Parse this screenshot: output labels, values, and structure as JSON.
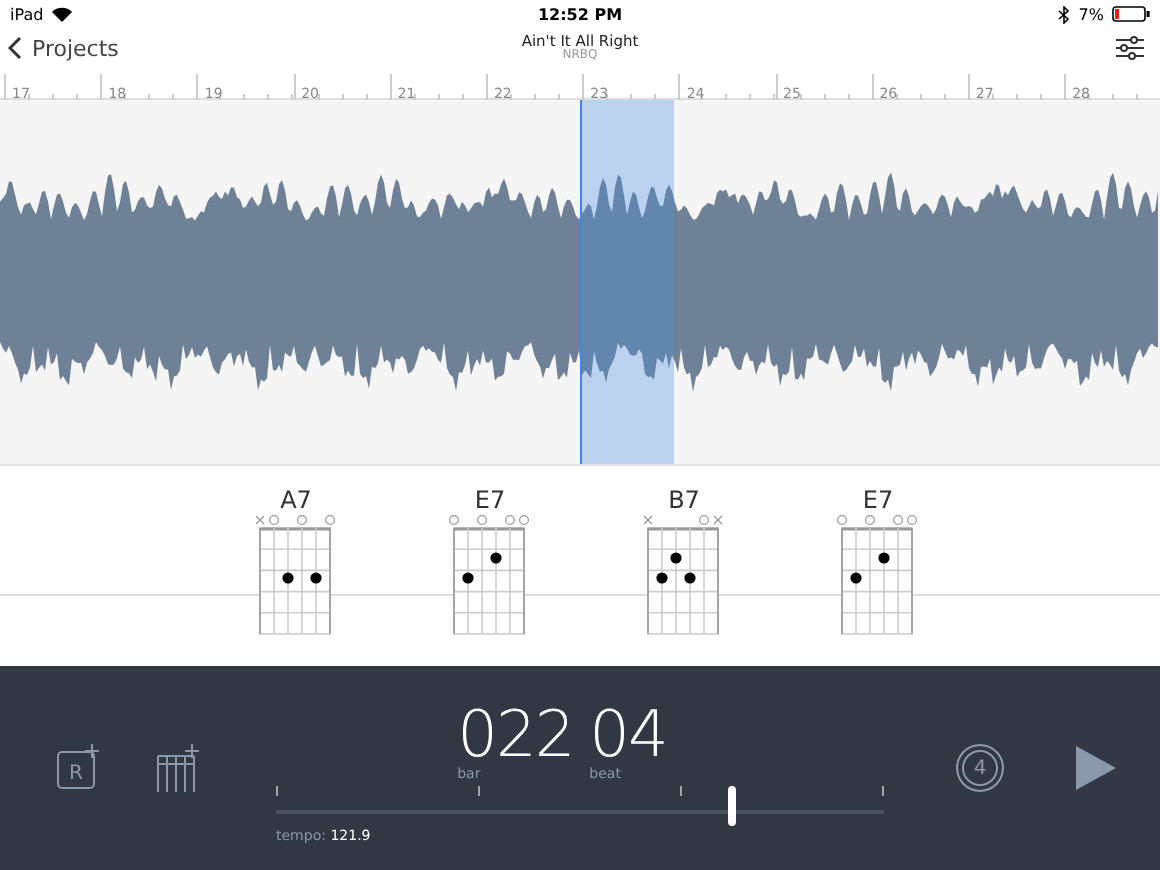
{
  "status_bar": {
    "device": "iPad",
    "time": "12:52 PM",
    "battery": "7%"
  },
  "nav": {
    "back": "Projects",
    "title": "Ain't It All Right",
    "subtitle": "NRBQ"
  },
  "ruler": {
    "bars": [
      "17",
      "18",
      "19",
      "20",
      "21",
      "22",
      "23",
      "24",
      "25",
      "26",
      "27",
      "28"
    ]
  },
  "chords": [
    {
      "name": "A7",
      "strings": [
        {
          "kind": "muted"
        },
        {
          "kind": "open"
        },
        {
          "kind": "fret2"
        },
        {
          "kind": "open"
        },
        {
          "kind": "fret2"
        },
        {
          "kind": "open"
        }
      ]
    },
    {
      "name": "E7",
      "strings": [
        {
          "kind": "open"
        },
        {
          "kind": "fret2"
        },
        {
          "kind": "open"
        },
        {
          "kind": "fret1"
        },
        {
          "kind": "open"
        },
        {
          "kind": "open"
        }
      ]
    },
    {
      "name": "B7",
      "strings": [
        {
          "kind": "muted"
        },
        {
          "kind": "fret2"
        },
        {
          "kind": "fret1"
        },
        {
          "kind": "fret2"
        },
        {
          "kind": "open"
        },
        {
          "kind": "muted"
        }
      ]
    },
    {
      "name": "E7",
      "strings": [
        {
          "kind": "open"
        },
        {
          "kind": "fret2"
        },
        {
          "kind": "open"
        },
        {
          "kind": "fret1"
        },
        {
          "kind": "open"
        },
        {
          "kind": "open"
        }
      ]
    }
  ],
  "counter": {
    "bar": "022",
    "bar_label": "bar",
    "beat": "04",
    "beat_label": "beat"
  },
  "tempo": {
    "label": "tempo:",
    "value": "121.9",
    "level": 0.75
  },
  "count_in": "4",
  "region_button": "R"
}
